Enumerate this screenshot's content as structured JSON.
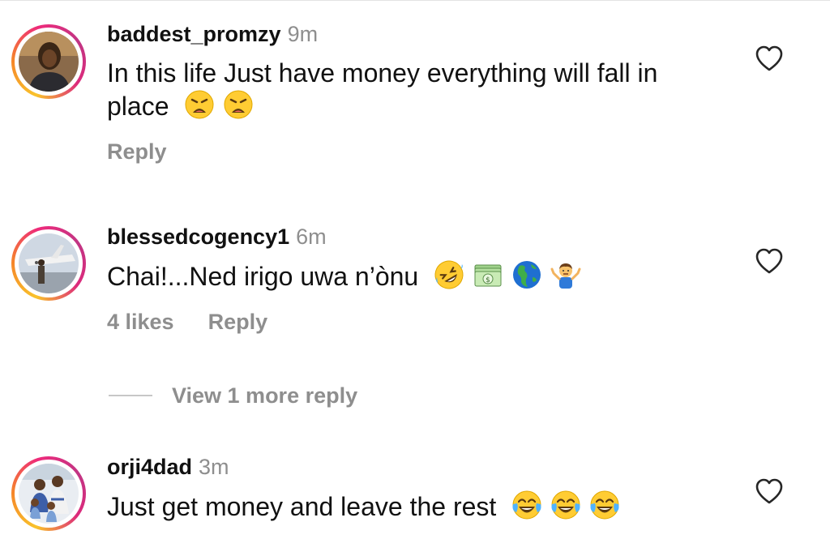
{
  "comments": [
    {
      "username": "baddest_promzy",
      "time": "9m",
      "text": "In this life Just have money everything will fall in place",
      "emojis": [
        "weary-face",
        "weary-face"
      ],
      "reply_label": "Reply"
    },
    {
      "username": "blessedcogency1",
      "time": "6m",
      "text": "Chai!...Ned irigo uwa n’ònu",
      "emojis": [
        "rolling-on-floor-laughing",
        "dollar-banknote",
        "globe-americas",
        "man-shrugging"
      ],
      "likes_label": "4 likes",
      "reply_label": "Reply"
    },
    {
      "username": "orji4dad",
      "time": "3m",
      "text": "Just get money and leave the rest",
      "emojis": [
        "face-with-tears-of-joy",
        "face-with-tears-of-joy",
        "face-with-tears-of-joy"
      ]
    }
  ],
  "view_more_label": "View 1 more reply",
  "colors": {
    "text": "#111111",
    "secondary": "#8e8e8e",
    "story_ring_start": "#f9c32b",
    "story_ring_end": "#c13584"
  },
  "icons": [
    "heart-outline-icon"
  ]
}
